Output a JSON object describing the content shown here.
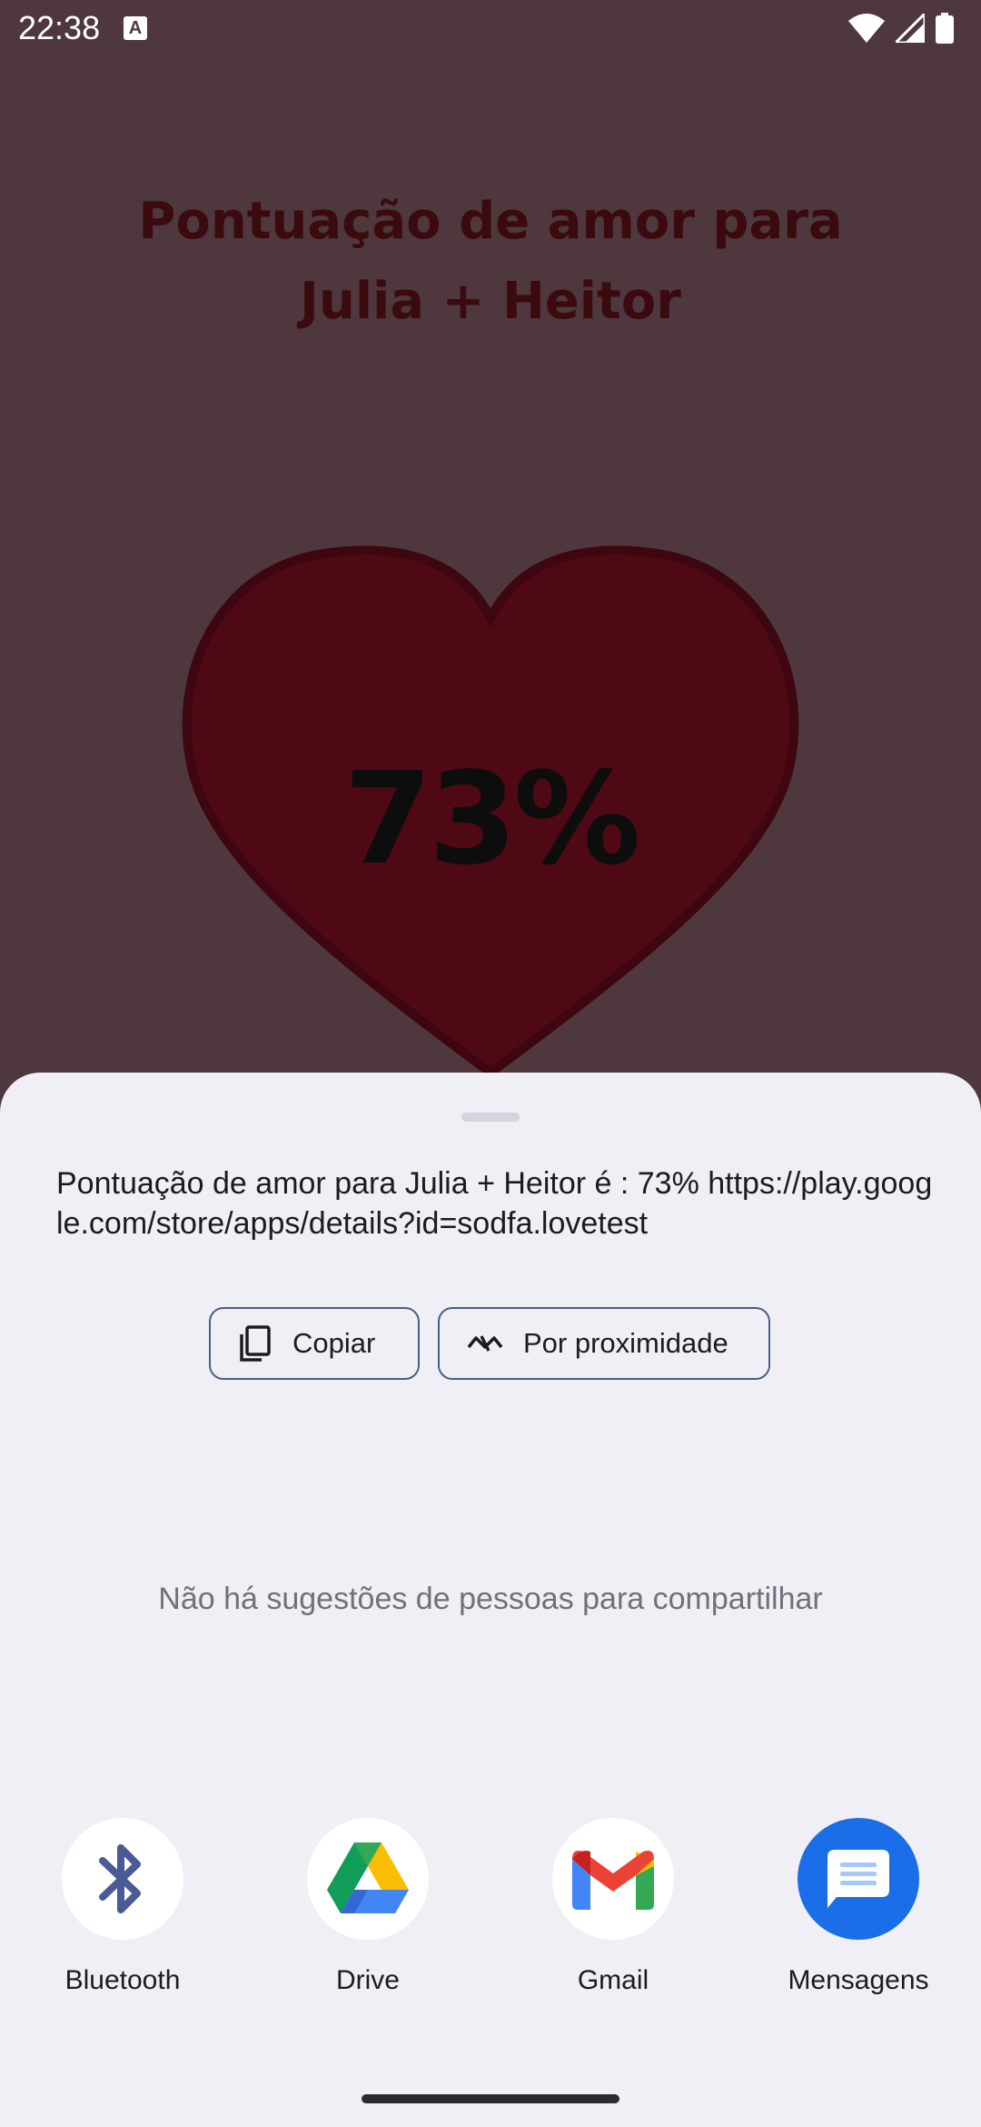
{
  "status_bar": {
    "time": "22:38",
    "icons": [
      "notification-a-icon",
      "wifi-icon",
      "signal-icon",
      "battery-icon"
    ]
  },
  "app": {
    "title_line1": "Pontuação de amor para",
    "title_line2": "Julia + Heitor",
    "score": "73%",
    "heart_color": "#4f0915"
  },
  "share_sheet": {
    "text": "Pontuação de amor para Julia + Heitor é : 73% https://play.google.com/store/apps/details?id=sodfa.lovetest",
    "copy_label": "Copiar",
    "nearby_label": "Por proximidade",
    "no_suggestions": "Não há sugestões de pessoas para compartilhar",
    "targets": [
      {
        "label": "Bluetooth",
        "icon": "bluetooth-icon"
      },
      {
        "label": "Drive",
        "icon": "google-drive-icon"
      },
      {
        "label": "Gmail",
        "icon": "gmail-icon"
      },
      {
        "label": "Mensagens",
        "icon": "messages-icon"
      }
    ]
  },
  "colors": {
    "scrim_bg": "#4e373d",
    "sheet_bg": "#f1eff6",
    "chip_border": "#4b5e88",
    "messages_blue": "#1a6ee8"
  }
}
